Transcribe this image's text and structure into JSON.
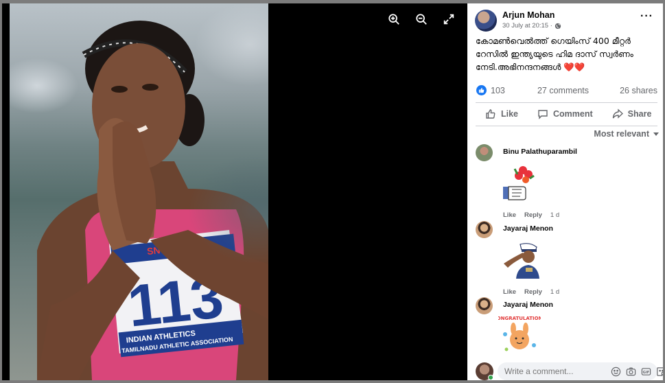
{
  "viewer": {
    "tools": [
      {
        "name": "zoom-in-icon"
      },
      {
        "name": "zoom-out-icon"
      },
      {
        "name": "fullscreen-icon"
      }
    ],
    "photo": {
      "bib_number": "113",
      "sponsor_text": "SN",
      "bib_line1": "INDIAN ATHLETICS",
      "bib_line2": "TAMILNADU ATHLETIC ASSOCIATION"
    }
  },
  "post": {
    "author": "Arjun Mohan",
    "timestamp": "30 July at 20:15 ·",
    "text": "കോമൺവെൽത്ത് ഗെയിംസ് 400 മീറ്റർ റേസിൽ ഇന്ത്യയുടെ ഹിമ ദാസ് സ്വർണം നേടി.അഭിനന്ദനങ്ങൾ",
    "text_hearts": "❤️❤️",
    "reaction_count": "103",
    "comment_count": "27 comments",
    "share_count": "26 shares",
    "actions": {
      "like": "Like",
      "comment": "Comment",
      "share": "Share"
    },
    "sort_label": "Most relevant"
  },
  "comments": [
    {
      "name": "Binu Palathuparambil",
      "like": "Like",
      "reply": "Reply",
      "time": "1 d",
      "sticker": "flowers-like-sticker"
    },
    {
      "name": "Jayaraj Menon",
      "like": "Like",
      "reply": "Reply",
      "time": "1 d",
      "sticker": "salute-sticker"
    },
    {
      "name": "Jayaraj Menon",
      "sticker": "congratulations-sticker",
      "sticker_text": "CONGRATULATIONS"
    }
  ],
  "composer": {
    "placeholder": "Write a comment..."
  },
  "colors": {
    "accent": "#1877f2",
    "secondary_text": "#65676b",
    "online": "#31a24c",
    "heart": "#e0245e"
  }
}
